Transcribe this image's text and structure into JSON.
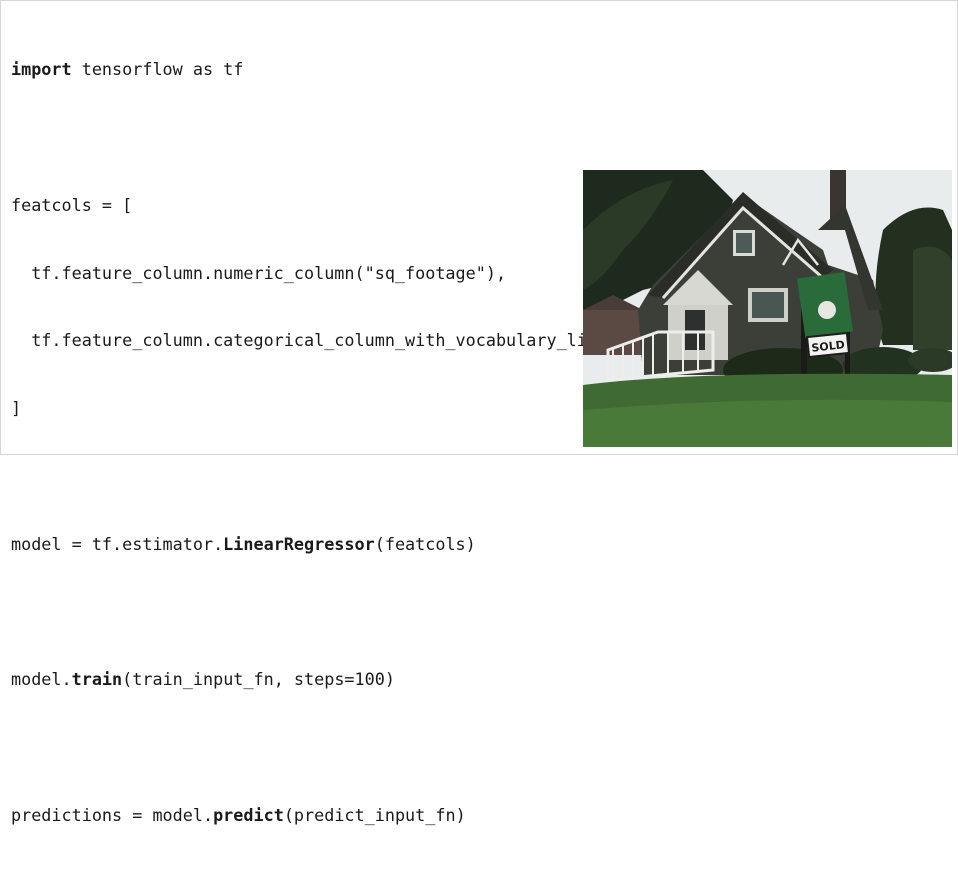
{
  "code": {
    "lines": [
      {
        "kw": "import",
        "rest": " tensorflow as tf"
      },
      {
        "kw": "",
        "rest": ""
      },
      {
        "kw": "",
        "rest": "featcols = ["
      },
      {
        "kw": "",
        "rest": "  tf.feature_column.numeric_column(\"sq_footage\"),"
      },
      {
        "kw": "",
        "rest": "  tf.feature_column.categorical_column_with_vocabulary_list(\"type\", [\"house\", \"apt\"])"
      },
      {
        "kw": "",
        "rest": "]"
      },
      {
        "kw": "",
        "rest": ""
      },
      {
        "pre": "model = tf.estimator.",
        "kw": "LinearRegressor",
        "rest": "(featcols)"
      },
      {
        "kw": "",
        "rest": ""
      },
      {
        "pre": "model.",
        "kw": "train",
        "rest": "(train_input_fn, steps=100)"
      },
      {
        "kw": "",
        "rest": ""
      },
      {
        "pre": "predictions = model.",
        "kw": "predict",
        "rest": "(predict_input_fn)"
      }
    ]
  },
  "photo": {
    "sign_text": "SOLD",
    "icon": "house-photo"
  }
}
